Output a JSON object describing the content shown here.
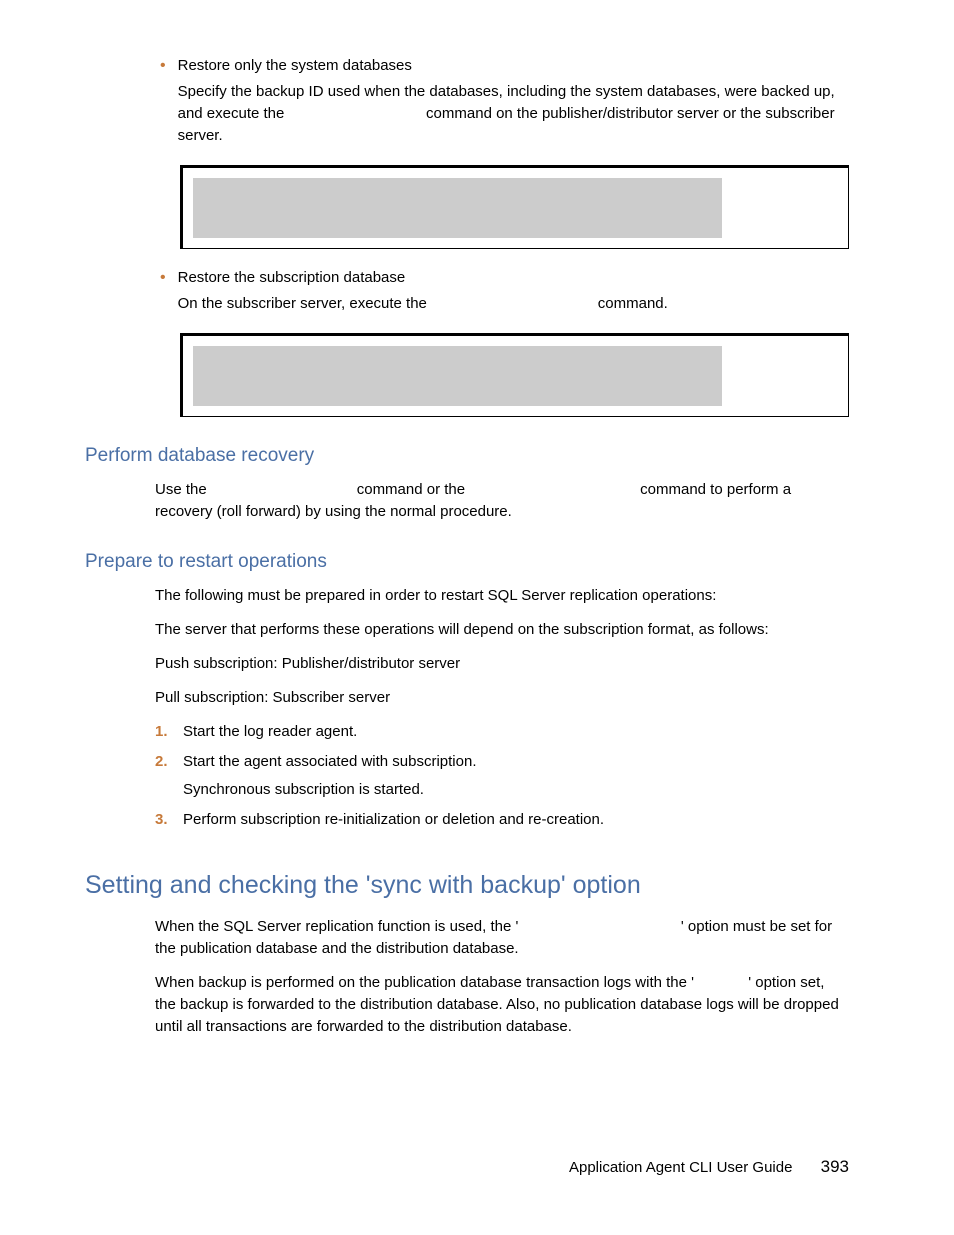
{
  "bullets": [
    {
      "title": "Restore only the system databases",
      "detail": "Specify the backup ID used when the databases, including the system databases, were backed up, and execute the                                  command on the publisher/distributor server or the subscriber server."
    },
    {
      "title": "Restore the subscription database",
      "detail": "On the subscriber server, execute the                                         command."
    }
  ],
  "sections": {
    "perform": {
      "heading": "Perform database recovery",
      "text": "Use the                                    command or the                                          command to perform a recovery (roll forward) by using the normal procedure."
    },
    "prepare": {
      "heading": "Prepare to restart operations",
      "p1": "The following must be prepared in order to restart SQL Server replication operations:",
      "p2": "The server that performs these operations will depend on the subscription format, as follows:",
      "p3": "Push subscription: Publisher/distributor server",
      "p4": "Pull subscription: Subscriber server",
      "steps": [
        {
          "num": "1.",
          "text": "Start the log reader agent.",
          "sub": ""
        },
        {
          "num": "2.",
          "text": "Start the agent associated with subscription.",
          "sub": "Synchronous subscription is started."
        },
        {
          "num": "3.",
          "text": "Perform subscription re-initialization or deletion and re-creation.",
          "sub": ""
        }
      ]
    },
    "setting": {
      "heading": "Setting and checking the 'sync with backup' option",
      "p1": "When the SQL Server replication function is used, the '                                       ' option must be set for the publication database and the distribution database.",
      "p2": "When backup is performed on the publication database transaction logs with the '             ' option set, the backup is forwarded to the distribution database. Also, no publication database logs will be dropped until all transactions are forwarded to the distribution database."
    }
  },
  "footer": {
    "title": "Application Agent CLI User Guide",
    "page": "393"
  }
}
